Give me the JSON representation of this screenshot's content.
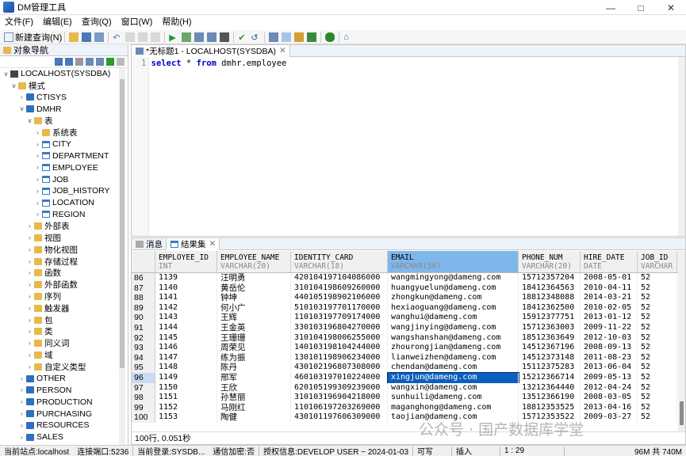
{
  "window": {
    "title": "DM管理工具"
  },
  "menu": [
    "文件(F)",
    "编辑(E)",
    "查询(Q)",
    "窗口(W)",
    "帮助(H)"
  ],
  "toolbar": {
    "new_query": "新建查询(N)"
  },
  "nav": {
    "title": "对象导航",
    "tree": [
      {
        "level": 0,
        "twisty": "v",
        "icon": "server",
        "label": "LOCALHOST(SYSDBA)"
      },
      {
        "level": 1,
        "twisty": "v",
        "icon": "folder",
        "label": "模式"
      },
      {
        "level": 2,
        "twisty": ">",
        "icon": "schema",
        "label": "CTISYS"
      },
      {
        "level": 2,
        "twisty": "v",
        "icon": "schema",
        "label": "DMHR"
      },
      {
        "level": 3,
        "twisty": "v",
        "icon": "folder",
        "label": "表"
      },
      {
        "level": 4,
        "twisty": ">",
        "icon": "folder",
        "label": "系统表"
      },
      {
        "level": 4,
        "twisty": ">",
        "icon": "table",
        "label": "CITY"
      },
      {
        "level": 4,
        "twisty": ">",
        "icon": "table",
        "label": "DEPARTMENT"
      },
      {
        "level": 4,
        "twisty": ">",
        "icon": "table",
        "label": "EMPLOYEE"
      },
      {
        "level": 4,
        "twisty": ">",
        "icon": "table",
        "label": "JOB"
      },
      {
        "level": 4,
        "twisty": ">",
        "icon": "table",
        "label": "JOB_HISTORY"
      },
      {
        "level": 4,
        "twisty": ">",
        "icon": "table",
        "label": "LOCATION"
      },
      {
        "level": 4,
        "twisty": ">",
        "icon": "table",
        "label": "REGION"
      },
      {
        "level": 3,
        "twisty": ">",
        "icon": "folder",
        "label": "外部表"
      },
      {
        "level": 3,
        "twisty": ">",
        "icon": "folder",
        "label": "视图"
      },
      {
        "level": 3,
        "twisty": ">",
        "icon": "folder",
        "label": "物化视图"
      },
      {
        "level": 3,
        "twisty": ">",
        "icon": "folder",
        "label": "存储过程"
      },
      {
        "level": 3,
        "twisty": ">",
        "icon": "folder",
        "label": "函数"
      },
      {
        "level": 3,
        "twisty": ">",
        "icon": "folder",
        "label": "外部函数"
      },
      {
        "level": 3,
        "twisty": ">",
        "icon": "folder",
        "label": "序列"
      },
      {
        "level": 3,
        "twisty": ">",
        "icon": "folder",
        "label": "触发器"
      },
      {
        "level": 3,
        "twisty": ">",
        "icon": "folder",
        "label": "包"
      },
      {
        "level": 3,
        "twisty": ">",
        "icon": "folder",
        "label": "类"
      },
      {
        "level": 3,
        "twisty": ">",
        "icon": "folder",
        "label": "同义词"
      },
      {
        "level": 3,
        "twisty": ">",
        "icon": "folder",
        "label": "域"
      },
      {
        "level": 3,
        "twisty": ">",
        "icon": "folder",
        "label": "自定义类型"
      },
      {
        "level": 2,
        "twisty": ">",
        "icon": "schema",
        "label": "OTHER"
      },
      {
        "level": 2,
        "twisty": ">",
        "icon": "schema",
        "label": "PERSON"
      },
      {
        "level": 2,
        "twisty": ">",
        "icon": "schema",
        "label": "PRODUCTION"
      },
      {
        "level": 2,
        "twisty": ">",
        "icon": "schema",
        "label": "PURCHASING"
      },
      {
        "level": 2,
        "twisty": ">",
        "icon": "schema",
        "label": "RESOURCES"
      },
      {
        "level": 2,
        "twisty": ">",
        "icon": "schema",
        "label": "SALES"
      }
    ]
  },
  "editor": {
    "tab": "*无标题1 - LOCALHOST(SYSDBA)",
    "line_no": "1",
    "sql": {
      "kw1": "select",
      "mid1": " * ",
      "kw2": "from",
      "rest": " dmhr.employee"
    }
  },
  "results": {
    "tab_messages": "消息",
    "tab_results": "结果集",
    "columns": [
      {
        "name": "EMPLOYEE_ID",
        "type": "INT"
      },
      {
        "name": "EMPLOYEE_NAME",
        "type": "VARCHAR(20)"
      },
      {
        "name": "IDENTITY_CARD",
        "type": "VARCHAR(18)"
      },
      {
        "name": "EMAIL",
        "type": "VARCHAR(50)"
      },
      {
        "name": "PHONE_NUM",
        "type": "VARCHAR(20)"
      },
      {
        "name": "HIRE_DATE",
        "type": "DATE"
      },
      {
        "name": "JOB_ID",
        "type": "VARCHAR"
      }
    ],
    "rows": [
      [
        "86",
        "1139",
        "汪明勇",
        "420104197104086000",
        "wangmingyong@dameng.com",
        "15712357204",
        "2008-05-01",
        "52"
      ],
      [
        "87",
        "1140",
        "黄岳伦",
        "310104198609260000",
        "huangyuelun@dameng.com",
        "18412364563",
        "2010-04-11",
        "52"
      ],
      [
        "88",
        "1141",
        "钟坤",
        "440105198902106000",
        "zhongkun@dameng.com",
        "18812348088",
        "2014-03-21",
        "52"
      ],
      [
        "89",
        "1142",
        "何小广",
        "510103197701170000",
        "hexiaoguang@dameng.com",
        "18412362500",
        "2010-02-05",
        "52"
      ],
      [
        "90",
        "1143",
        "王辉",
        "110103197709174000",
        "wanghui@dameng.com",
        "15912377751",
        "2013-01-12",
        "52"
      ],
      [
        "91",
        "1144",
        "王金英",
        "330103196804270000",
        "wangjinying@dameng.com",
        "15712363003",
        "2009-11-22",
        "52"
      ],
      [
        "92",
        "1145",
        "王珊珊",
        "310104198006255000",
        "wangshanshan@dameng.com",
        "18512363649",
        "2012-10-03",
        "52"
      ],
      [
        "93",
        "1146",
        "周荣见",
        "140103198104244000",
        "zhourongjian@dameng.com",
        "14512367196",
        "2008-09-13",
        "52"
      ],
      [
        "94",
        "1147",
        "练为振",
        "130101198906234000",
        "lianweizhen@dameng.com",
        "14512373148",
        "2011-08-23",
        "52"
      ],
      [
        "95",
        "1148",
        "陈丹",
        "430102196807308000",
        "chendan@dameng.com",
        "15112375283",
        "2013-06-04",
        "52"
      ],
      [
        "96",
        "1149",
        "邢军",
        "460103197010224000",
        "xingjun@dameng.com",
        "15212366714",
        "2009-05-13",
        "52"
      ],
      [
        "97",
        "1150",
        "王欣",
        "620105199309239000",
        "wangxin@dameng.com",
        "13212364440",
        "2012-04-24",
        "52"
      ],
      [
        "98",
        "1151",
        "孙慧丽",
        "310103196904218000",
        "sunhuili@dameng.com",
        "13512366190",
        "2008-03-05",
        "52"
      ],
      [
        "99",
        "1152",
        "马刚红",
        "110106197203269000",
        "maganghong@dameng.com",
        "18812353525",
        "2013-04-16",
        "52"
      ],
      [
        "100",
        "1153",
        "陶健",
        "430101197606309000",
        "taojian@dameng.com",
        "15712353522",
        "2009-03-27",
        "52"
      ]
    ],
    "selected_row_index": 10,
    "summary": "100行, 0.051秒"
  },
  "status": {
    "site": "当前站点:localhost",
    "port": "连接端口:5236",
    "login": "当前登录:SYSDB...",
    "encryption": "通信加密:否",
    "license": "授权信息:DEVELOP USER ~ 2024-01-03",
    "mode": "可写",
    "insert": "插入",
    "cursor": "1 : 29",
    "memory": "96M 共 740M"
  },
  "watermark": "公众号 · 国产数据库学堂",
  "colors": {
    "accent": "#0c5fbf",
    "selected_header": "#7fb7ea",
    "keyword": "#0000cc"
  }
}
